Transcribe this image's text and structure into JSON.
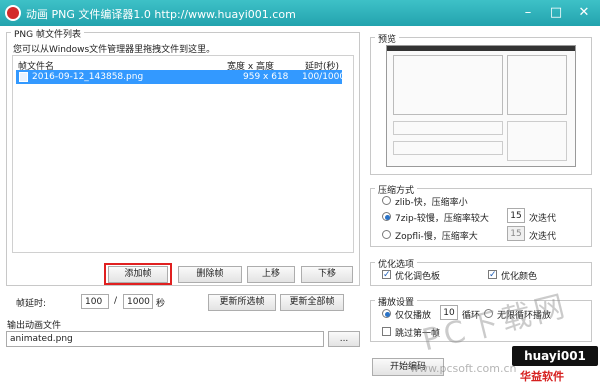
{
  "window": {
    "title": "动画 PNG 文件编译器1.0    http://www.huayi001.com"
  },
  "frames_group": {
    "title": "PNG 帧文件列表",
    "hint": "您可以从Windows文件管理器里拖拽文件到这里。",
    "columns": [
      "帧文件名",
      "宽度 x 高度",
      "延时(秒)"
    ],
    "rows": [
      {
        "name": "2016-09-12_143858.png",
        "size": "959 x 618",
        "delay": "100/1000",
        "selected": true
      }
    ],
    "buttons": {
      "add": "添加帧",
      "delete": "删除帧",
      "up": "上移",
      "down": "下移"
    },
    "delay_label": "帧延时:",
    "delay_num": "100",
    "slash": "/",
    "delay_den": "1000",
    "delay_unit": "秒",
    "update_selected": "更新所选帧",
    "update_all": "更新全部帧"
  },
  "output": {
    "label": "输出动画文件",
    "value": "animated.png",
    "browse": "..."
  },
  "preview": {
    "title": "预览"
  },
  "compression": {
    "title": "压缩方式",
    "options": [
      {
        "label": "zlib-快，压缩率小",
        "selected": false
      },
      {
        "label": "7zip-较慢，压缩率较大",
        "selected": true,
        "iter_value": "15",
        "iter_label": "次迭代"
      },
      {
        "label": "Zopfli-慢，压缩率大",
        "selected": false,
        "iter_value": "15",
        "iter_label": "次迭代"
      }
    ]
  },
  "optimize": {
    "title": "优化选项",
    "palette": {
      "label": "优化调色板",
      "checked": true
    },
    "color": {
      "label": "优化颜色",
      "checked": true
    }
  },
  "playback": {
    "title": "播放设置",
    "play_once": "仅仅播放",
    "loop_value": "10",
    "loop_label": "循环",
    "infinite": "无限循环播放",
    "skip_first": "跳过第一帧"
  },
  "actions": {
    "compile": "开始编码"
  },
  "watermark": {
    "line1": "PC下载网",
    "line2": "www.pcsoft.com.cn",
    "logo": "huayi001",
    "logo_sub": "华益软件"
  },
  "colors": {
    "titlebar": "#23a3ae",
    "selection": "#3399ff",
    "highlight_border": "#e02020"
  }
}
